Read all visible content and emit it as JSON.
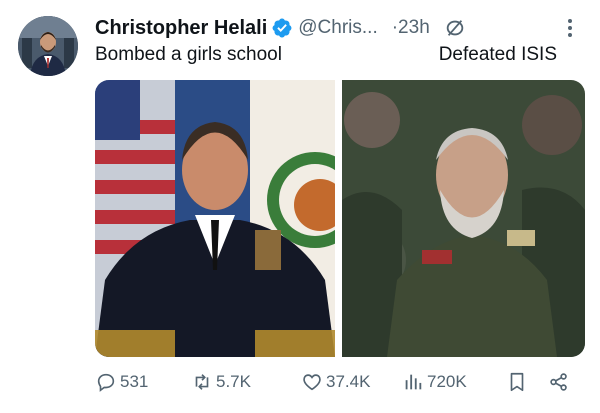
{
  "tweet": {
    "author_name": "Christopher Helali",
    "handle": "@Chris...",
    "separator_time": "·23h",
    "icons": {
      "avatar": "profile-photo",
      "verified": "verified-badge-icon",
      "hidden": "eye-slash-icon",
      "more": "more-vertical-icon"
    },
    "colors": {
      "verified": "#1d9bf0",
      "meta": "#536471",
      "text": "#0f1419"
    },
    "captions": {
      "left": "Bombed a girls school",
      "right": "Defeated ISIS"
    },
    "media": [
      "photo-naval-officer-with-flags",
      "photo-commander-green-uniform"
    ],
    "stats": {
      "replies": "531",
      "retweets": "5.7K",
      "likes": "37.4K",
      "views": "720K"
    }
  }
}
